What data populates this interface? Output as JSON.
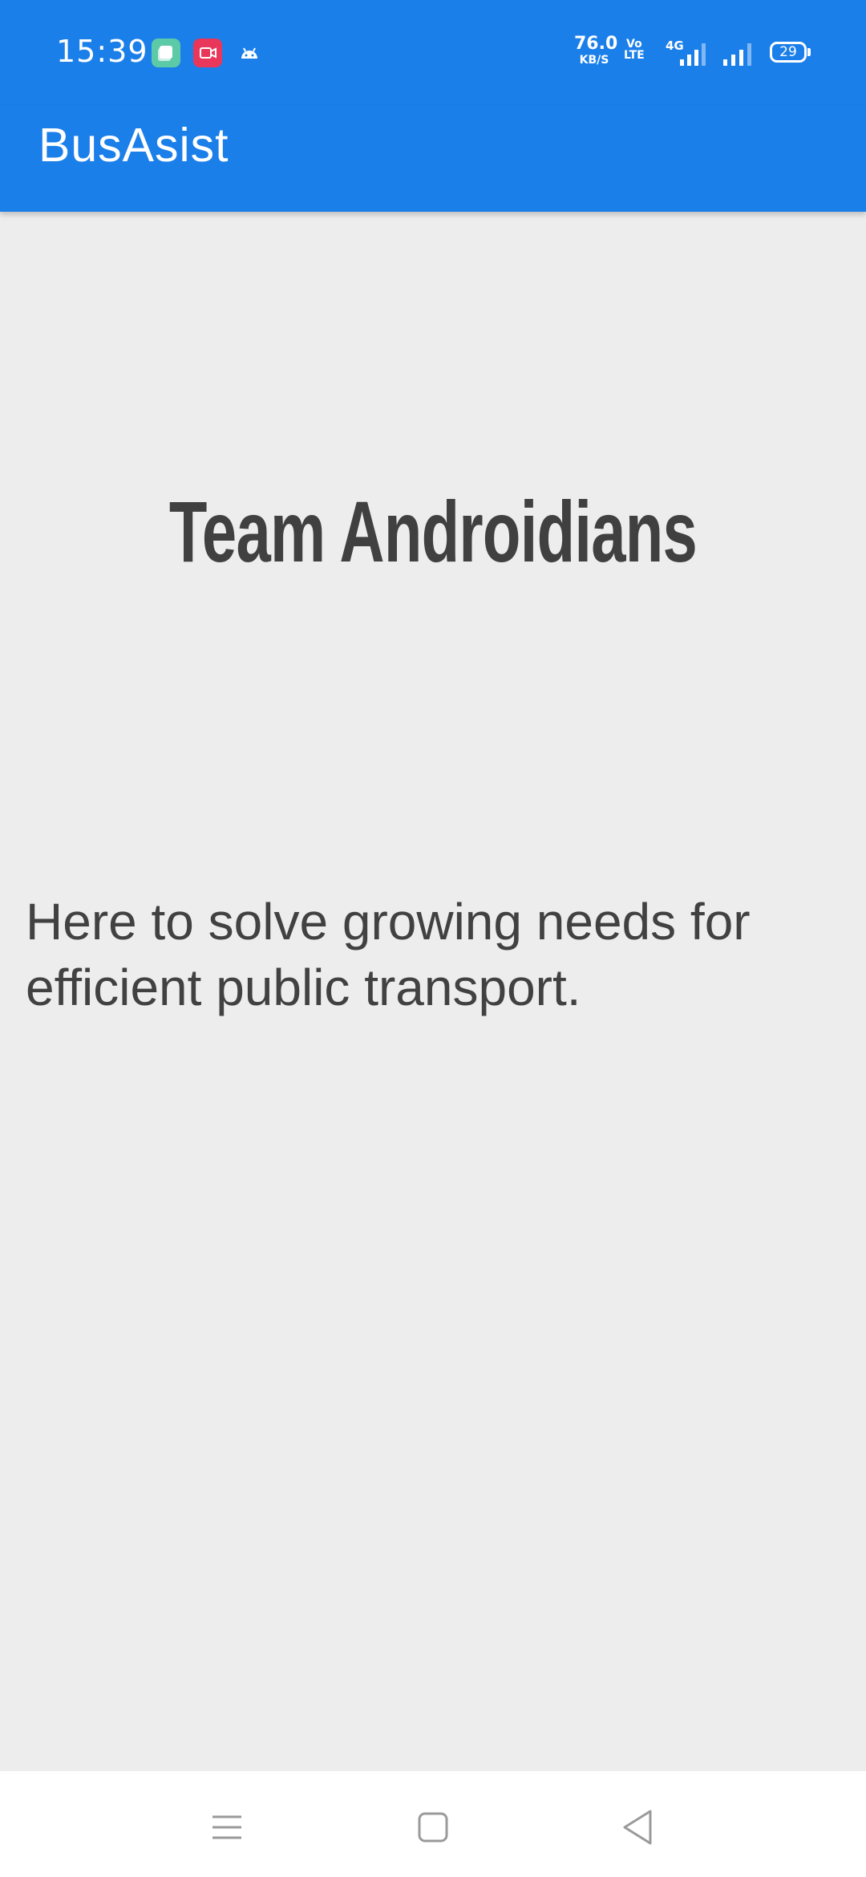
{
  "status_bar": {
    "time": "15:39",
    "notifications": [
      "gallery-icon",
      "screen-recorder-icon",
      "android-icon"
    ],
    "net_speed_value": "76.0",
    "net_speed_unit": "KB/S",
    "volte_top": "Vo",
    "volte_bottom": "LTE",
    "network_type": "4G",
    "battery_level": "29"
  },
  "app_bar": {
    "title": "BusAsist"
  },
  "content": {
    "team_name": "Team Androidians",
    "tagline": "Here to solve growing needs for efficient public transport."
  },
  "colors": {
    "primary": "#1b7fea",
    "background": "#ededed",
    "text": "#414141"
  },
  "nav_bar": {
    "buttons": [
      "menu-icon",
      "home-icon",
      "back-icon"
    ]
  }
}
